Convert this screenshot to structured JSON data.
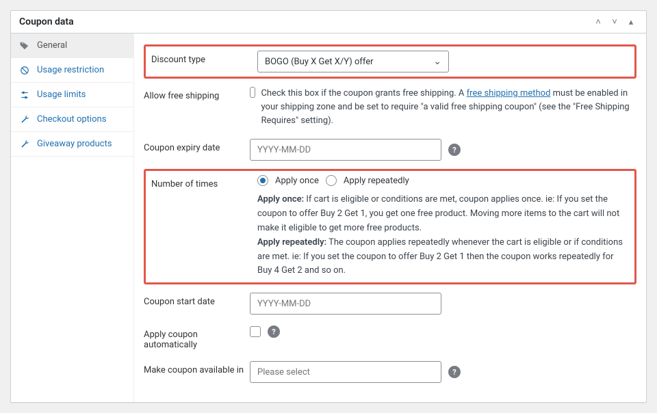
{
  "panel": {
    "title": "Coupon data"
  },
  "sidebar": {
    "tabs": [
      {
        "label": "General"
      },
      {
        "label": "Usage restriction"
      },
      {
        "label": "Usage limits"
      },
      {
        "label": "Checkout options"
      },
      {
        "label": "Giveaway products"
      }
    ]
  },
  "form": {
    "discount_type": {
      "label": "Discount type",
      "value": "BOGO (Buy X Get X/Y) offer"
    },
    "free_shipping": {
      "label": "Allow free shipping",
      "desc_prefix": "Check this box if the coupon grants free shipping. A ",
      "link_text": "free shipping method",
      "desc_suffix": " must be enabled in your shipping zone and be set to require \"a valid free shipping coupon\" (see the \"Free Shipping Requires\" setting)."
    },
    "expiry": {
      "label": "Coupon expiry date",
      "placeholder": "YYYY-MM-DD"
    },
    "number_of_times": {
      "label": "Number of times",
      "option1": "Apply once",
      "option2": "Apply repeatedly",
      "help_once_label": "Apply once:",
      "help_once_text": " If cart is eligible or conditions are met, coupon applies once. ie: If you set the coupon to offer Buy 2 Get 1, you get one free product. Moving more items to the cart will not make it eligible to get more free products.",
      "help_repeat_label": "Apply repeatedly:",
      "help_repeat_text": " The coupon applies repeatedly whenever the cart is eligible or if conditions are met. ie: If you set the coupon to offer Buy 2 Get 1 then the coupon works repeatedly for Buy 4 Get 2 and so on."
    },
    "start_date": {
      "label": "Coupon start date",
      "placeholder": "YYYY-MM-DD"
    },
    "auto_apply": {
      "label": "Apply coupon automatically"
    },
    "available_in": {
      "label": "Make coupon available in",
      "placeholder": "Please select"
    }
  }
}
